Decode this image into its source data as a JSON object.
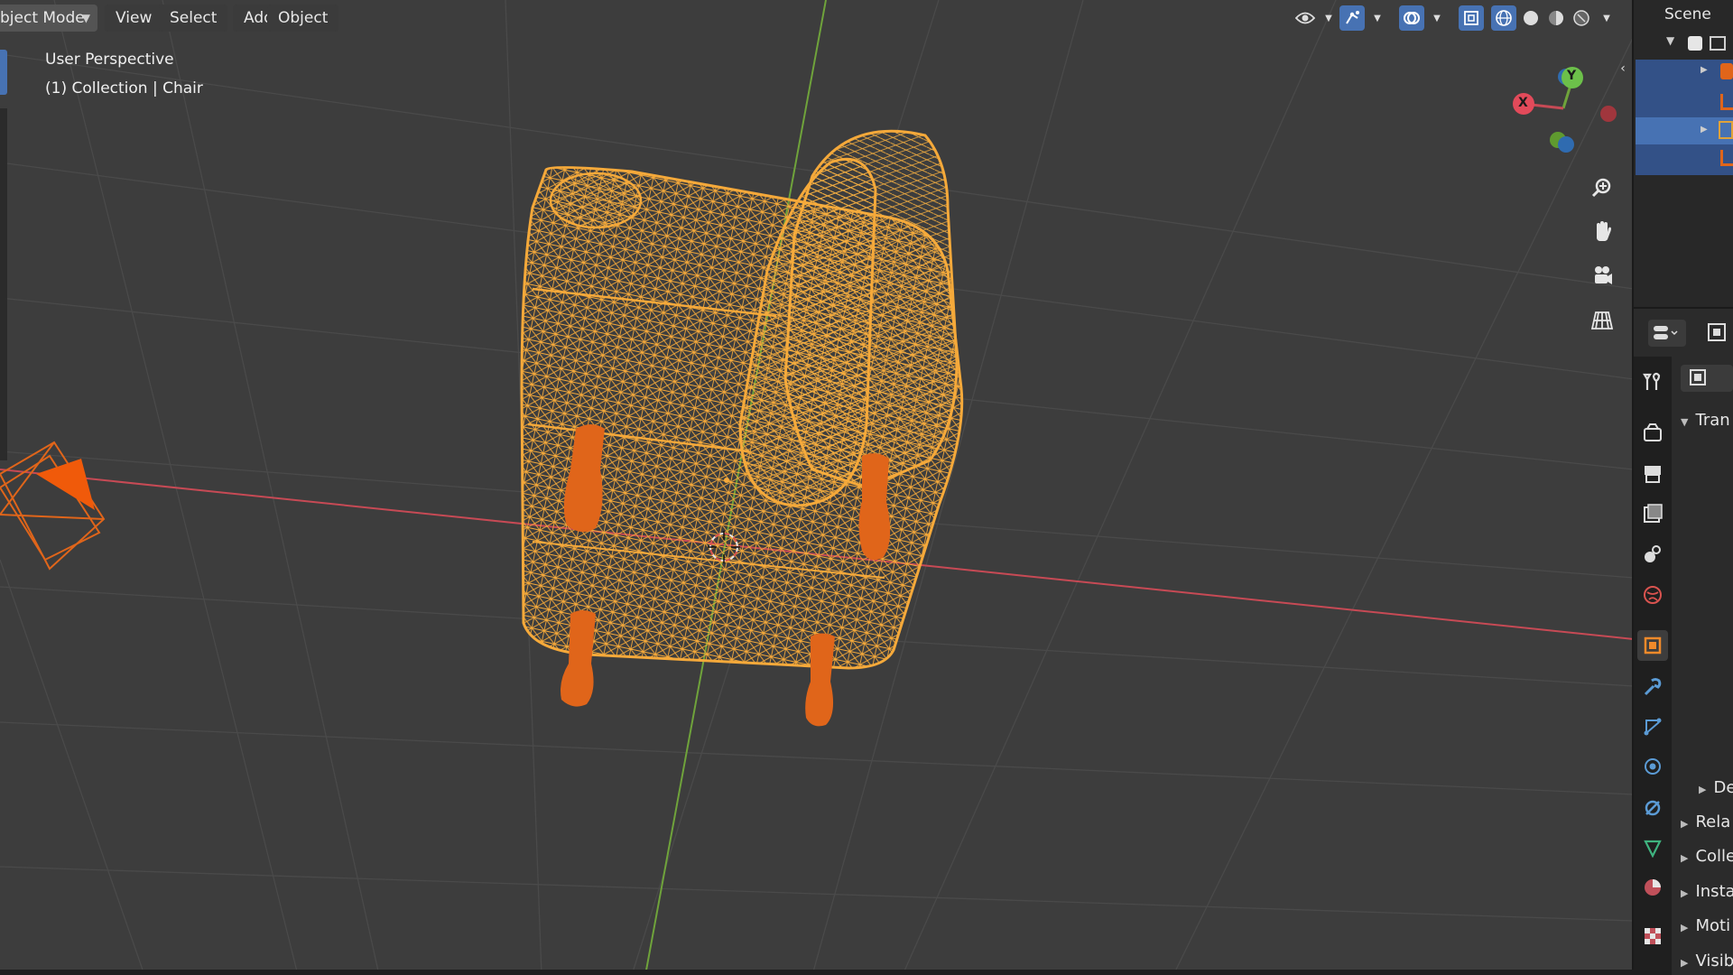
{
  "header": {
    "mode_label": "bject Mode",
    "menus": [
      "View",
      "Select",
      "Add",
      "Object"
    ]
  },
  "viewport": {
    "perspective_label": "User Perspective",
    "collection_label": "(1) Collection | Chair"
  },
  "gizmo": {
    "x_label": "X",
    "y_label": "Y"
  },
  "outliner": {
    "title": "Scene"
  },
  "properties": {
    "section_transform": "Tran",
    "section_delta": "De",
    "sections": [
      "Rela",
      "Colle",
      "Insta",
      "Moti",
      "Visib"
    ]
  },
  "colors": {
    "viewport_bg": "#3d3d3d",
    "wire_selected": "#f5a93a",
    "legs": "#e0651a",
    "x_axis": "#c74a55",
    "y_axis": "#6fa33b",
    "selection_blue": "#335187"
  }
}
